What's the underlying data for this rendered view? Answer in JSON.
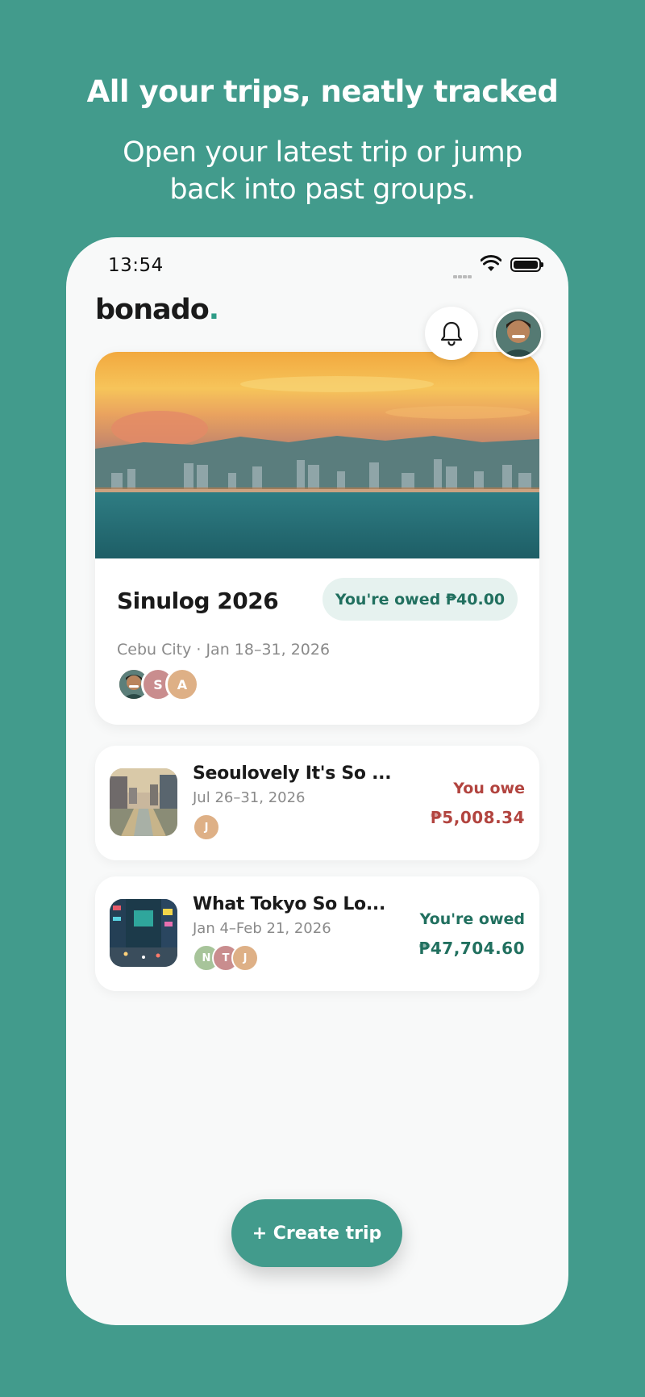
{
  "headline": "All your trips, neatly tracked",
  "subline": "Open your latest trip or jump back into past groups.",
  "status_bar": {
    "time": "13:54"
  },
  "app": {
    "logo_text": "bonado",
    "logo_dot": "."
  },
  "featured_trip": {
    "name": "Sinulog 2026",
    "status": "You're owed ₱40.00",
    "location_dates": "Cebu City · Jan 18–31, 2026",
    "members": [
      {
        "initial": "",
        "type": "photo"
      },
      {
        "initial": "S",
        "color": "#c98d8e"
      },
      {
        "initial": "A",
        "color": "#deb086"
      }
    ]
  },
  "trips": [
    {
      "name": "Seoulovely It's So ...",
      "dates": "Jul 26–31, 2026",
      "status": "You owe",
      "amount": "₱5,008.34",
      "members": [
        {
          "initial": "J",
          "color": "#deb086"
        }
      ]
    },
    {
      "name": "What Tokyo So Lo...",
      "dates": "Jan 4–Feb 21, 2026",
      "status": "You're owed",
      "amount": "₱47,704.60",
      "members": [
        {
          "initial": "N",
          "color": "#a7c49a"
        },
        {
          "initial": "T",
          "color": "#c98d8e"
        },
        {
          "initial": "J",
          "color": "#deb086"
        }
      ]
    }
  ],
  "create_button": "+ Create trip",
  "colors": {
    "brand": "#429b8c",
    "positive": "#21705f",
    "negative": "#b2443f",
    "pill_bg": "#e6f2ef"
  }
}
